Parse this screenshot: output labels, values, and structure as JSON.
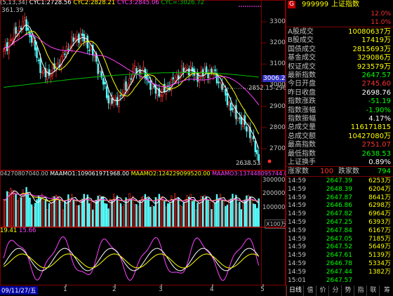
{
  "header": {
    "ma_prefix": "(5,13,34)",
    "cyc1": "CYC1:2728.56",
    "cyc2": "CYC2:2828.21",
    "cyc3": "CYC3:2845.06",
    "cyc4": "CYC∞:3026.72",
    "top_left_value": "361.39"
  },
  "price_axis": {
    "ticks": [
      "3300",
      "3200",
      "3100",
      "3000",
      "2900",
      "2800",
      "2700"
    ],
    "current_tag": "3006.2",
    "annotation_high": "2852.15-2965",
    "annotation_low": "2638.53"
  },
  "volume_panel": {
    "header_prefix": "04270807040.00",
    "maamo1": "MAAMO1:109061971968.00",
    "maamo2": "MAAMO2:124229099520.00",
    "maamo3": "MAAMO3:137448095744.00",
    "axis": [
      "300000",
      "200000",
      "100000"
    ],
    "unit": "X100万"
  },
  "osc_panel": {
    "header_prefix": "19.41",
    "value2": "15.66"
  },
  "time_axis": {
    "start_label": "09/11/27/五",
    "month_labels": [
      "1",
      "2",
      "3",
      "4",
      "5"
    ]
  },
  "colors": {
    "up": "#ff3030",
    "down": "#54ffff",
    "ma_white": "#ffffff",
    "ma_yellow": "#ffff00",
    "ma_magenta": "#ff40ff",
    "ma_green": "#00c000",
    "positive": "#ff3030",
    "negative": "#00ff00",
    "neutral": "#ffffff",
    "label": "#c0c0c0",
    "grid": "#800000"
  },
  "right_panel": {
    "code_badge": "G",
    "code": "999999",
    "name": "上证指数",
    "header_ratios": [
      "12.0%",
      "11.0%"
    ],
    "indicators": [
      {
        "label": "A股成交",
        "value": "10080637万",
        "color": "#ffff00"
      },
      {
        "label": "B股成交",
        "value": "17419万",
        "color": "#ffff00"
      },
      {
        "label": "国债成交",
        "value": "2815693万",
        "color": "#ffff00"
      },
      {
        "label": "基金成交",
        "value": "329086万",
        "color": "#ffff00"
      },
      {
        "label": "权证成交",
        "value": "923579万",
        "color": "#ffff00"
      },
      {
        "label": "最新指数",
        "value": "2647.57",
        "color": "#00ff00"
      },
      {
        "label": "今日开盘",
        "value": "2745.60",
        "color": "#ff3030"
      },
      {
        "label": "昨日收盘",
        "value": "2698.76",
        "color": "#ffffff"
      },
      {
        "label": "指数涨跌",
        "value": "-51.19",
        "color": "#00ff00"
      },
      {
        "label": "指数涨幅",
        "value": "-1.90%",
        "color": "#00ff00"
      },
      {
        "label": "指数振幅",
        "value": "4.17%",
        "color": "#ffffff"
      },
      {
        "label": "总成交量",
        "value": "116171815",
        "color": "#ffff00"
      },
      {
        "label": "总成交额",
        "value": "10427080万",
        "color": "#ffff00"
      },
      {
        "label": "最高指数",
        "value": "2751.07",
        "color": "#ff3030"
      },
      {
        "label": "最低指数",
        "value": "2638.53",
        "color": "#00ff00"
      },
      {
        "label": "上证换手",
        "value": "0.89%",
        "color": "#ffffff"
      }
    ],
    "breadth": {
      "up_label": "涨家数",
      "up_count": "100",
      "down_label": "跌家数",
      "down_count": "794"
    },
    "ticks": [
      {
        "time": "14:59",
        "price": "2647.39",
        "vol": "6253万"
      },
      {
        "time": "14:59",
        "price": "2648.39",
        "vol": "6204万"
      },
      {
        "time": "14:59",
        "price": "2647.87",
        "vol": "8641万"
      },
      {
        "time": "14:59",
        "price": "2646.86",
        "vol": "6298万"
      },
      {
        "time": "14:59",
        "price": "2647.82",
        "vol": "6964万"
      },
      {
        "time": "14:59",
        "price": "2647.25",
        "vol": "6393万"
      },
      {
        "time": "14:59",
        "price": "2647.84",
        "vol": "6167万"
      },
      {
        "time": "14:59",
        "price": "2647.05",
        "vol": "7185万"
      },
      {
        "time": "14:59",
        "price": "2647.52",
        "vol": "5649万"
      },
      {
        "time": "14:59",
        "price": "2647.61",
        "vol": "5139万"
      },
      {
        "time": "14:59",
        "price": "2646.78",
        "vol": "5334万"
      },
      {
        "time": "14:59",
        "price": "2647.44",
        "vol": "1382万"
      },
      {
        "time": "15:01",
        "price": "2647.57",
        "vol": ""
      }
    ],
    "tabs": [
      "日线",
      "值",
      "价",
      "分",
      "势",
      "指",
      "联",
      "筹"
    ]
  }
}
